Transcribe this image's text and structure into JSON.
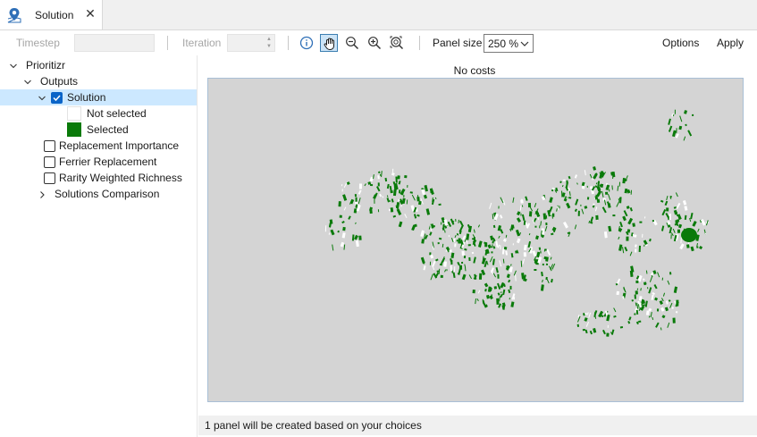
{
  "tab": {
    "label": "Solution",
    "icon": "map-pin-icon"
  },
  "toolbar": {
    "timestep_label": "Timestep",
    "iteration_label": "Iteration",
    "panel_size_label": "Panel size",
    "panel_size_value": "250 %",
    "options_label": "Options",
    "apply_label": "Apply"
  },
  "tree": {
    "root": "Prioritizr",
    "outputs": "Outputs",
    "solution": "Solution",
    "legend": [
      {
        "label": "Not selected",
        "color": "#ffffff"
      },
      {
        "label": "Selected",
        "color": "#0a7a0a"
      }
    ],
    "items": [
      {
        "label": "Replacement Importance",
        "checked": false
      },
      {
        "label": "Ferrier Replacement",
        "checked": false
      },
      {
        "label": "Rarity Weighted Richness",
        "checked": false
      }
    ],
    "comparison": "Solutions Comparison"
  },
  "map": {
    "title": "No costs",
    "background": "#d4d4d4",
    "selected_color": "#0a7a0a"
  },
  "status": {
    "text": "1 panel will be created based on your choices"
  }
}
